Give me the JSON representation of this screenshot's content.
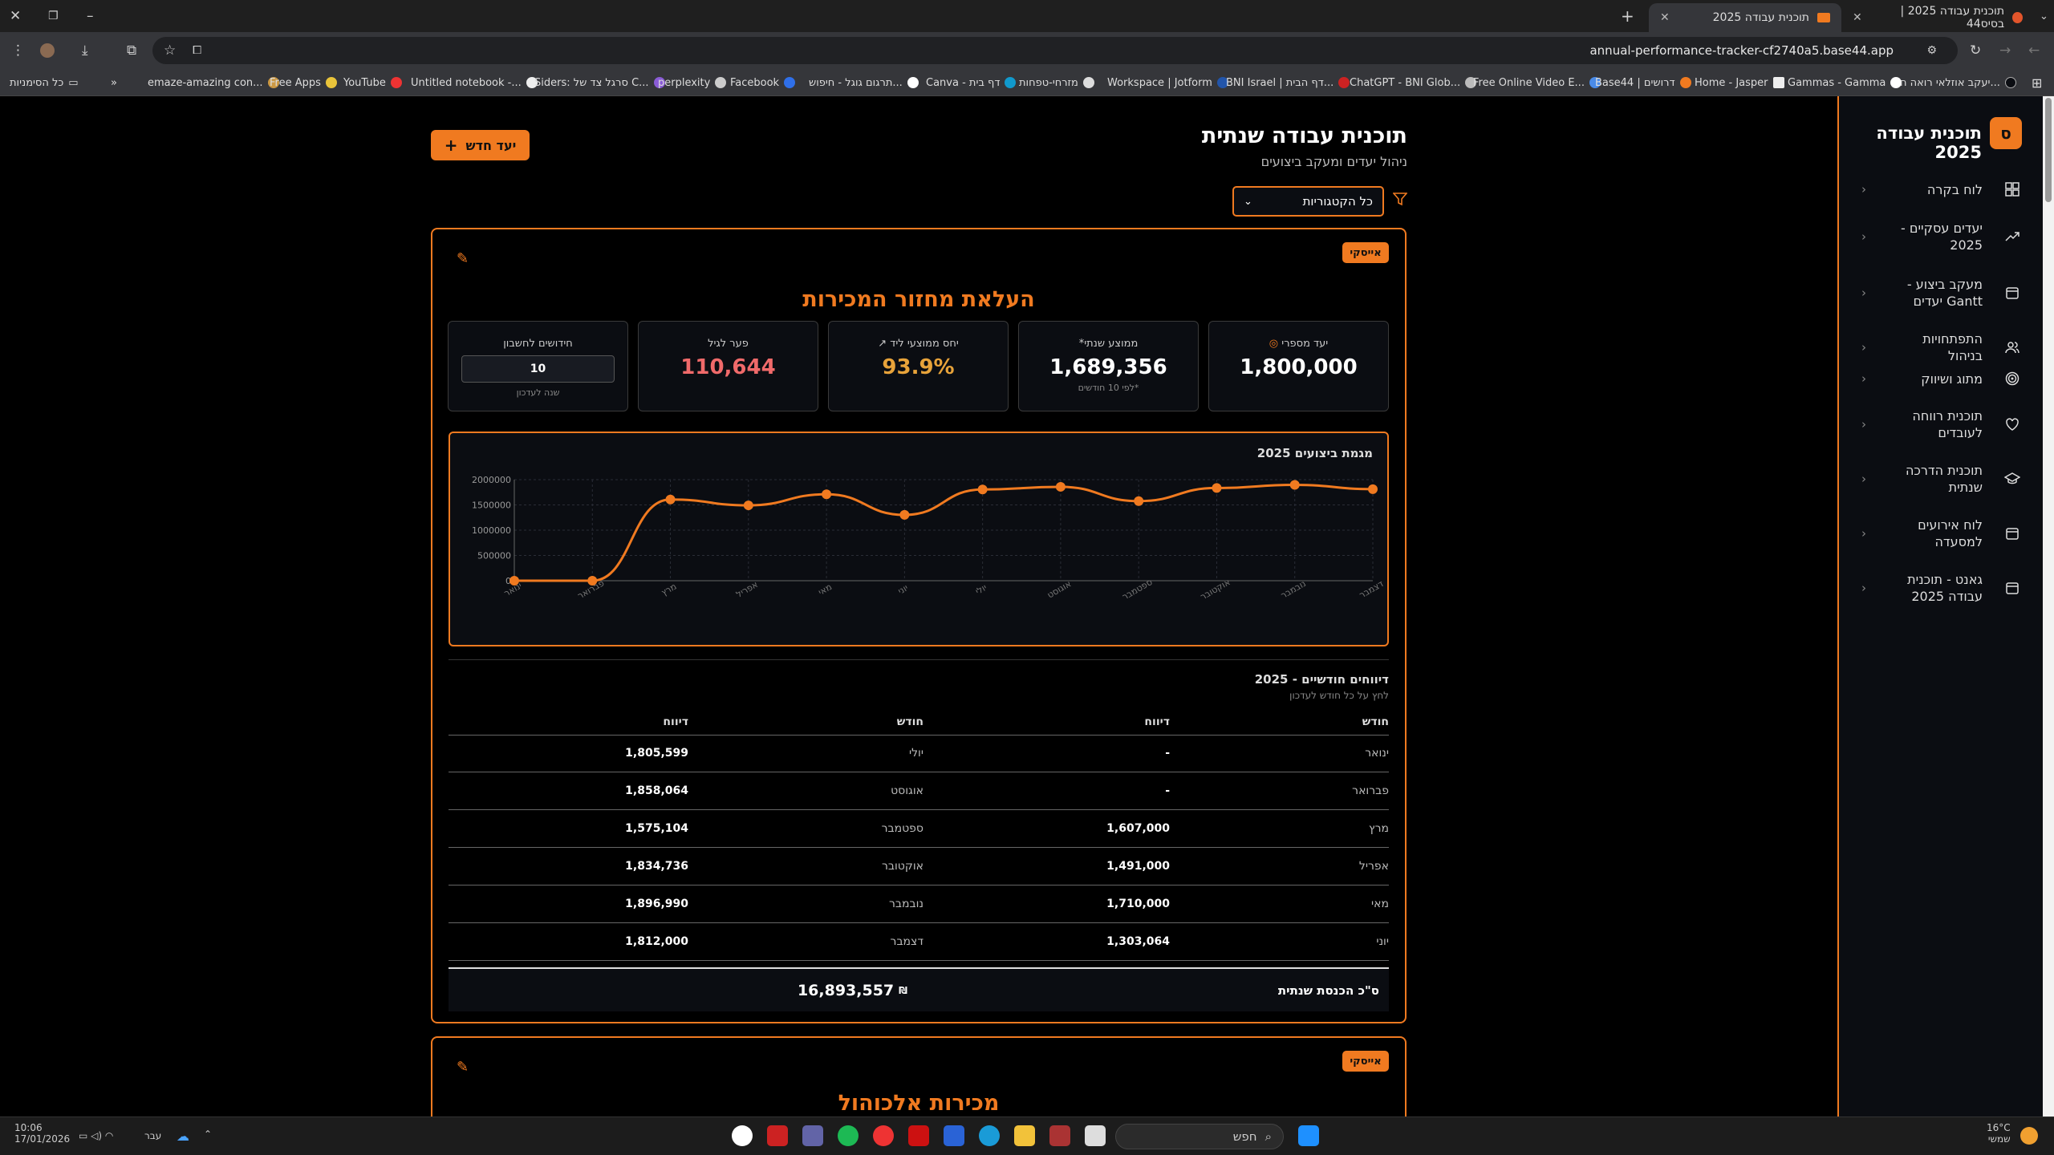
{
  "browser": {
    "tabs": [
      {
        "title": "תוכנית עבודה 2025 | בסיס44",
        "active": false
      },
      {
        "title": "תוכנית עבודה 2025",
        "active": true
      }
    ],
    "url": "annual-performance-tracker-cf2740a5.base44.app",
    "bookmarks": [
      "יעקב אוזלאי רואה ח...",
      "Gammas - Gamma",
      "Home - Jasper",
      "Base44 | דרושים",
      "Free Online Video E...",
      "ChatGPT - BNI Glob...",
      "BNI Israel | דף הבית...",
      "Workspace | Jotform",
      "מזרחי-טפחות",
      "Canva - דף בית",
      "תרגום גוגל - חיפוש...",
      "Facebook",
      "perplexity",
      "Siders: סרגל צד של C...",
      "Untitled notebook -...",
      "YouTube",
      "Free Apps",
      "emaze-amazing con..."
    ],
    "all_bookmarks": "כל הסימניות",
    "more": "»"
  },
  "sidebar": {
    "logo_letter": "ס",
    "title": "תוכנית עבודה 2025",
    "items": [
      {
        "label": "לוח בקרה",
        "icon": "dashboard-icon"
      },
      {
        "label": "יעדים עסקיים - 2025",
        "icon": "trending-up-icon"
      },
      {
        "label": "מעקב ביצוע - Gantt יעדים",
        "icon": "calendar-icon"
      },
      {
        "label": "התפתחויות בניהול",
        "icon": "users-icon"
      },
      {
        "label": "מתוג ושיווק",
        "icon": "target-icon"
      },
      {
        "label": "תוכנית רווחה לעובדים",
        "icon": "heart-icon"
      },
      {
        "label": "תוכנית הדרכה שנתית",
        "icon": "graduation-cap-icon"
      },
      {
        "label": "לוח אירועים למסעדה",
        "icon": "calendar-icon"
      },
      {
        "label": "גאנט - תוכנית עבודה 2025",
        "icon": "calendar-icon"
      }
    ]
  },
  "header": {
    "title": "תוכנית עבודה שנתית",
    "subtitle": "ניהול יעדים ומעקב ביצועים",
    "new_goal": "יעד חדש",
    "filter_value": "כל הקטגוריות"
  },
  "goal1": {
    "badge": "אייסקי",
    "title": "העלאת מחזור המכירות",
    "metrics": {
      "target": {
        "label": "יעד מספרי",
        "value": "1,800,000"
      },
      "average": {
        "label": "ממוצע שנתי*",
        "value": "1,689,356",
        "note": "*לפי 10 חודשים"
      },
      "ratio": {
        "label": "יחס ממוצעי ליד",
        "value": "93.9%"
      },
      "gap": {
        "label": "פער לגיל",
        "value": "110,644"
      },
      "months": {
        "label": "חידושים לחשבון",
        "value": "10",
        "note": "שנה לעדכון"
      }
    },
    "chart_title": "מגמת ביצועים 2025",
    "report_title": "דיווחים חודשיים - 2025",
    "report_sub": "לחץ על כל חודש לעדכון",
    "col_month": "חודש",
    "col_report": "דיווח",
    "rows": [
      {
        "r_month": "ינואר",
        "r_val": "-",
        "l_month": "יולי",
        "l_val": "1,805,599"
      },
      {
        "r_month": "פברואר",
        "r_val": "-",
        "l_month": "אוגוסט",
        "l_val": "1,858,064"
      },
      {
        "r_month": "מרץ",
        "r_val": "1,607,000",
        "l_month": "ספטמבר",
        "l_val": "1,575,104"
      },
      {
        "r_month": "אפריל",
        "r_val": "1,491,000",
        "l_month": "אוקטובר",
        "l_val": "1,834,736"
      },
      {
        "r_month": "מאי",
        "r_val": "1,710,000",
        "l_month": "נובמבר",
        "l_val": "1,896,990"
      },
      {
        "r_month": "יוני",
        "r_val": "1,303,064",
        "l_month": "דצמבר",
        "l_val": "1,812,000"
      }
    ],
    "total_label": "ס\"כ הכנסת שנתית",
    "total_value": "16,893,557"
  },
  "goal2": {
    "badge": "אייסקי",
    "title": "מכירות אלכוהול"
  },
  "taskbar": {
    "time": "10:06",
    "date": "17/01/2026",
    "lang": "עבר",
    "search": "חפש",
    "weather": "16°C",
    "weather_sub": "שמשי"
  },
  "colors": {
    "accent": "#f07a20",
    "ratio": "#e8a33a",
    "gap": "#f06a6a"
  },
  "chart_data": {
    "type": "line",
    "title": "מגמת ביצועים 2025",
    "categories": [
      "ינואר",
      "פברואר",
      "מרץ",
      "אפריל",
      "מאי",
      "יוני",
      "יולי",
      "אוגוסט",
      "ספטמבר",
      "אוקטובר",
      "נובמבר",
      "דצמבר"
    ],
    "values": [
      0,
      0,
      1607000,
      1491000,
      1710000,
      1303064,
      1805599,
      1858064,
      1575104,
      1834736,
      1896990,
      1812000
    ],
    "yticks": [
      "0",
      "500000",
      "1000000",
      "1500000",
      "2000000"
    ],
    "ylim": [
      0,
      2000000
    ],
    "grid": true
  }
}
